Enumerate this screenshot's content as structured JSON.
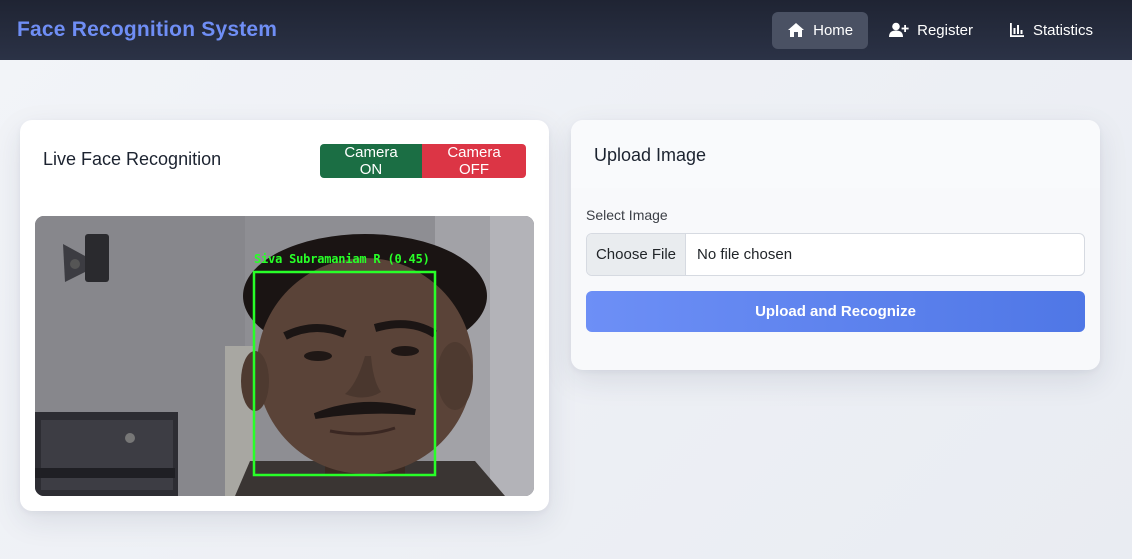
{
  "app": {
    "brand": "Face Recognition System"
  },
  "nav": {
    "items": [
      {
        "label": "Home",
        "icon": "home-icon",
        "active": true
      },
      {
        "label": "Register",
        "icon": "user-plus-icon",
        "active": false
      },
      {
        "label": "Statistics",
        "icon": "chart-icon",
        "active": false
      }
    ]
  },
  "live": {
    "title": "Live Face Recognition",
    "camera_on_label": "Camera ON",
    "camera_off_label": "Camera OFF",
    "detection_label": "Siva Subramaniam R (0.45)"
  },
  "upload": {
    "title": "Upload Image",
    "field_label": "Select Image",
    "choose_file_label": "Choose File",
    "file_status": "No file chosen",
    "submit_label": "Upload and Recognize"
  },
  "colors": {
    "brand": "#6f8ef5",
    "camera_on": "#1b6e44",
    "camera_off": "#dc3545",
    "detection_box": "#28ff28",
    "primary": "#5b82ee"
  }
}
